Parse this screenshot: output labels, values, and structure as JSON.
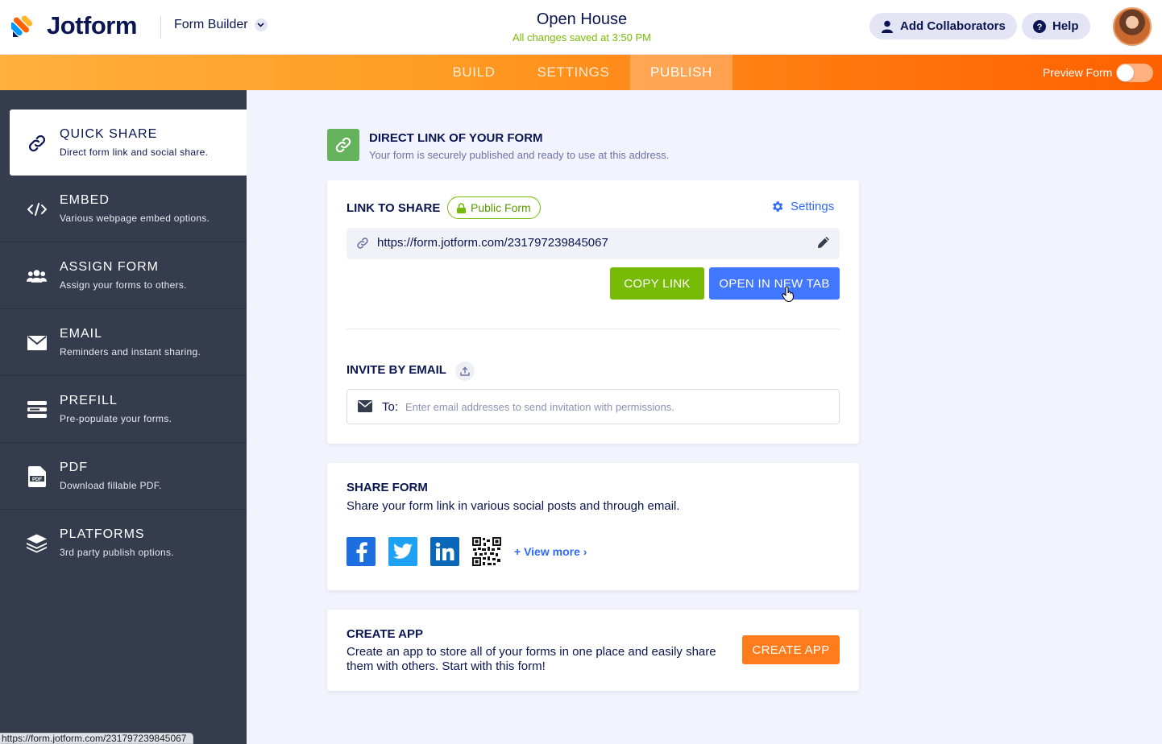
{
  "header": {
    "brand": "Jotform",
    "builder_label": "Form Builder",
    "form_title": "Open House",
    "save_status": "All changes saved at 3:50 PM",
    "add_collaborators": "Add Collaborators",
    "help": "Help"
  },
  "nav": {
    "tabs": [
      {
        "label": "BUILD",
        "active": false
      },
      {
        "label": "SETTINGS",
        "active": false
      },
      {
        "label": "PUBLISH",
        "active": true
      }
    ],
    "preview_label": "Preview Form",
    "preview_on": false
  },
  "sidebar": {
    "items": [
      {
        "title": "QUICK SHARE",
        "desc": "Direct form link and social share.",
        "icon": "link-icon",
        "active": true
      },
      {
        "title": "EMBED",
        "desc": "Various webpage embed options.",
        "icon": "code-icon"
      },
      {
        "title": "ASSIGN FORM",
        "desc": "Assign your forms to others.",
        "icon": "users-icon"
      },
      {
        "title": "EMAIL",
        "desc": "Reminders and instant sharing.",
        "icon": "envelope-icon"
      },
      {
        "title": "PREFILL",
        "desc": "Pre-populate your forms.",
        "icon": "prefill-icon"
      },
      {
        "title": "PDF",
        "desc": "Download fillable PDF.",
        "icon": "pdf-icon"
      },
      {
        "title": "PLATFORMS",
        "desc": "3rd party publish options.",
        "icon": "layers-icon"
      }
    ]
  },
  "main": {
    "section_title": "DIRECT LINK OF YOUR FORM",
    "section_desc": "Your form is securely published and ready to use at this address.",
    "link_label": "LINK TO SHARE",
    "badge": "Public Form",
    "settings": "Settings",
    "url": "https://form.jotform.com/231797239845067",
    "copy_link": "COPY LINK",
    "open_new_tab": "OPEN IN NEW TAB",
    "invite_label": "INVITE BY EMAIL",
    "to_label": "To:",
    "email_placeholder": "Enter email addresses to send invitation with permissions.",
    "share_title": "SHARE FORM",
    "share_desc": "Share your form link in various social posts and through email.",
    "view_more": "View more",
    "app_title": "CREATE APP",
    "app_desc": "Create an app to store all of your forms in one place and easily share them with others. Start with this form!",
    "create_app": "CREATE APP"
  },
  "status_bar": "https://form.jotform.com/231797239845067",
  "colors": {
    "brand_navy": "#0a1551",
    "accent_orange": "#ff7b1c",
    "green": "#78bb07",
    "blue": "#4277ff",
    "sidebar": "#343c4e"
  }
}
